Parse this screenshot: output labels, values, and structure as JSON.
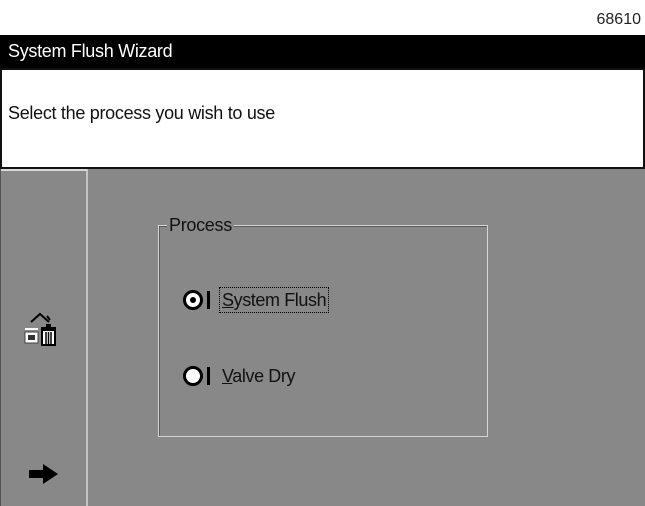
{
  "figure_id": "68610",
  "window": {
    "title": "System Flush Wizard"
  },
  "prompt": {
    "text": "Select the process you wish to use"
  },
  "toolbar": {
    "buttons": [
      {
        "name": "delete",
        "icon": "trash-icon"
      },
      {
        "name": "next",
        "icon": "arrow-right-icon"
      }
    ]
  },
  "process_group": {
    "label": "Process",
    "options": [
      {
        "label_rest": "ystem Flush",
        "mnemonic": "S",
        "selected": true,
        "focused": true
      },
      {
        "label_rest": "alve Dry",
        "mnemonic": "V",
        "selected": false,
        "focused": false
      }
    ]
  },
  "colors": {
    "background": "#888888",
    "title_bar": "#000000",
    "prompt_bg": "#ffffff"
  }
}
